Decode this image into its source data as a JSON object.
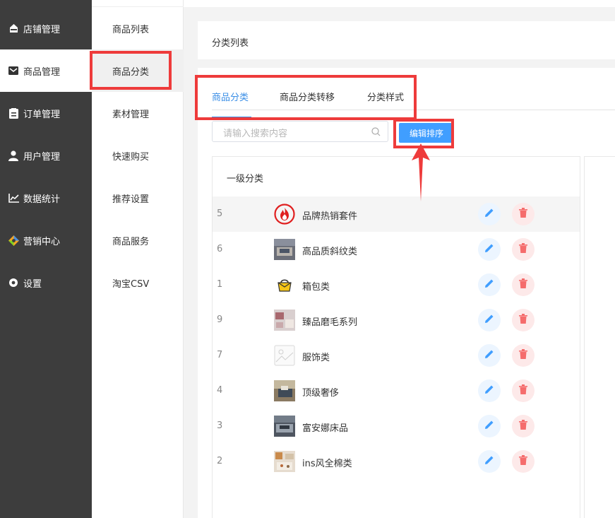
{
  "sidebar": {
    "items": [
      {
        "label": "店铺管理",
        "icon": "store-icon"
      },
      {
        "label": "商品管理",
        "icon": "mail-icon"
      },
      {
        "label": "订单管理",
        "icon": "order-icon"
      },
      {
        "label": "用户管理",
        "icon": "user-icon"
      },
      {
        "label": "数据统计",
        "icon": "chart-icon"
      },
      {
        "label": "营销中心",
        "icon": "marketing-icon"
      },
      {
        "label": "设置",
        "icon": "gear-icon"
      }
    ],
    "active_index": 1
  },
  "subnav": {
    "items": [
      "商品列表",
      "商品分类",
      "素材管理",
      "快速购买",
      "推荐设置",
      "商品服务",
      "淘宝CSV"
    ],
    "active_index": 1
  },
  "page": {
    "title": "分类列表"
  },
  "tabs": [
    "商品分类",
    "商品分类转移",
    "分类样式"
  ],
  "search": {
    "placeholder": "请输入搜索内容"
  },
  "toolbar": {
    "edit_sort_label": "编辑排序"
  },
  "panel": {
    "title": "一级分类",
    "rows": [
      {
        "index": "5",
        "name": "品牌热销套件",
        "thumb": "fire-logo"
      },
      {
        "index": "6",
        "name": "高品质斜纹类",
        "thumb": "photo"
      },
      {
        "index": "1",
        "name": "箱包类",
        "thumb": "bag-icon"
      },
      {
        "index": "9",
        "name": "臻品磨毛系列",
        "thumb": "photo"
      },
      {
        "index": "7",
        "name": "服饰类",
        "thumb": "placeholder-image"
      },
      {
        "index": "4",
        "name": "顶级奢侈",
        "thumb": "photo"
      },
      {
        "index": "3",
        "name": "富安娜床品",
        "thumb": "photo"
      },
      {
        "index": "2",
        "name": "ins风全棉类",
        "thumb": "photo"
      }
    ]
  },
  "colors": {
    "accent": "#409eff",
    "sidebar_bg": "#3d3d3d",
    "annotation_red": "#ee3b3b",
    "delete_red": "#f56c6c"
  }
}
